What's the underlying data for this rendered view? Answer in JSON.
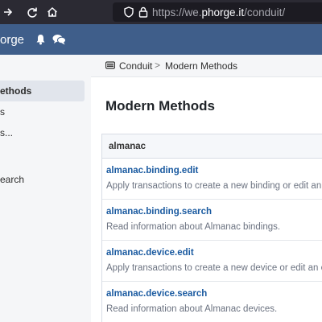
{
  "browser": {
    "url_prefix": "https://we.",
    "url_domain": "phorge.it",
    "url_path": "/conduit/"
  },
  "header": {
    "brand": "orge",
    "icons": [
      "bell-icon",
      "chat-bubbles-icon"
    ]
  },
  "sidebar": {
    "items": [
      {
        "label": "ethods",
        "active": true
      },
      {
        "label": "s"
      },
      {
        "label": "s..."
      },
      {
        "label": "earch"
      }
    ]
  },
  "breadcrumb": {
    "icon": "conduit-icon",
    "items": [
      "Conduit",
      "Modern Methods"
    ],
    "separator": ">"
  },
  "page": {
    "title": "Modern Methods",
    "group_label": "almanac",
    "methods": [
      {
        "name": "almanac.binding.edit",
        "description": "Apply transactions to create a new binding or edit an exis"
      },
      {
        "name": "almanac.binding.search",
        "description": "Read information about Almanac bindings."
      },
      {
        "name": "almanac.device.edit",
        "description": "Apply transactions to create a new device or edit an exist"
      },
      {
        "name": "almanac.device.search",
        "description": "Read information about Almanac devices."
      }
    ]
  },
  "colors": {
    "browser_bg": "#2b2a33",
    "header_bg": "#3f5e8a",
    "link": "#1a5aa0"
  }
}
